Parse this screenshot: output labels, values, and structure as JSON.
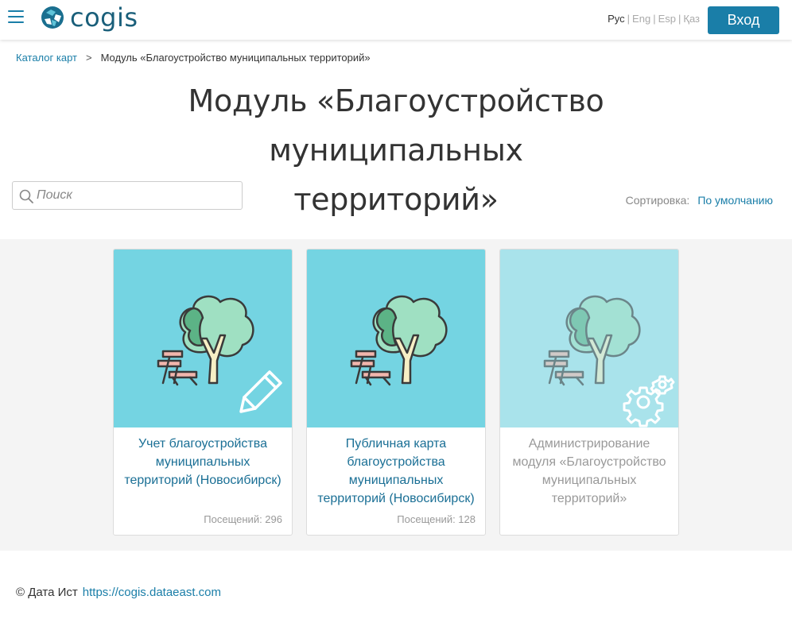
{
  "header": {
    "logo_text": "cogis",
    "languages": [
      {
        "label": "Рус",
        "active": true
      },
      {
        "label": "Eng",
        "active": false
      },
      {
        "label": "Esp",
        "active": false
      },
      {
        "label": "Қаз",
        "active": false
      }
    ],
    "login_label": "Вход",
    "colors": {
      "brand": "#1a7ea8",
      "logo": "#1a5f7a"
    }
  },
  "breadcrumb": {
    "root": "Каталог карт",
    "separator": ">",
    "current": "Модуль «Благоустройство муниципальных территорий»"
  },
  "page": {
    "title_line1": "Модуль «Благоустройство муниципальных",
    "title_line2": "территорий»"
  },
  "search": {
    "placeholder": "Поиск",
    "value": ""
  },
  "sort": {
    "label": "Сортировка:",
    "value": "По умолчанию"
  },
  "cards": [
    {
      "title": "Учет благоустройства муниципальных территорий (Новосибирск)",
      "visits": "Посещений: 296",
      "badge_icon": "pencil-icon",
      "disabled": false
    },
    {
      "title": "Публичная карта благоустройства муниципальных территорий (Новосибирск)",
      "visits": "Посещений: 128",
      "badge_icon": "",
      "disabled": false
    },
    {
      "title": "Администрирование модуля «Благоустройство муниципальных территорий»",
      "visits": "",
      "badge_icon": "gears-icon",
      "disabled": true
    }
  ],
  "footer": {
    "copyright": "© Дата Ист",
    "link": "https://cogis.dataeast.com"
  }
}
